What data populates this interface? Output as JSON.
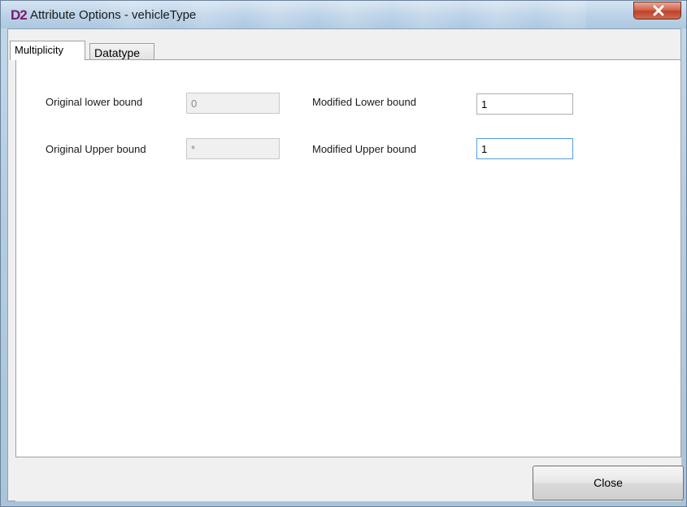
{
  "window": {
    "logo": "D2",
    "title": "Attribute Options - vehicleType",
    "close_icon": "close-x-icon"
  },
  "tabs": [
    {
      "label": "Multiplicity",
      "active": true
    },
    {
      "label": "Datatype",
      "active": false
    }
  ],
  "multiplicity": {
    "original_lower_label": "Original lower bound",
    "original_lower_value": "0",
    "original_upper_label": "Original Upper bound",
    "original_upper_value": "*",
    "modified_lower_label": "Modified Lower bound",
    "modified_lower_value": "1",
    "modified_upper_label": "Modified Upper bound",
    "modified_upper_value": "1"
  },
  "footer": {
    "close_label": "Close"
  },
  "colors": {
    "logo": "#7b1a6e",
    "close_button_red": "#c0422a",
    "focus_border": "#569de5"
  }
}
